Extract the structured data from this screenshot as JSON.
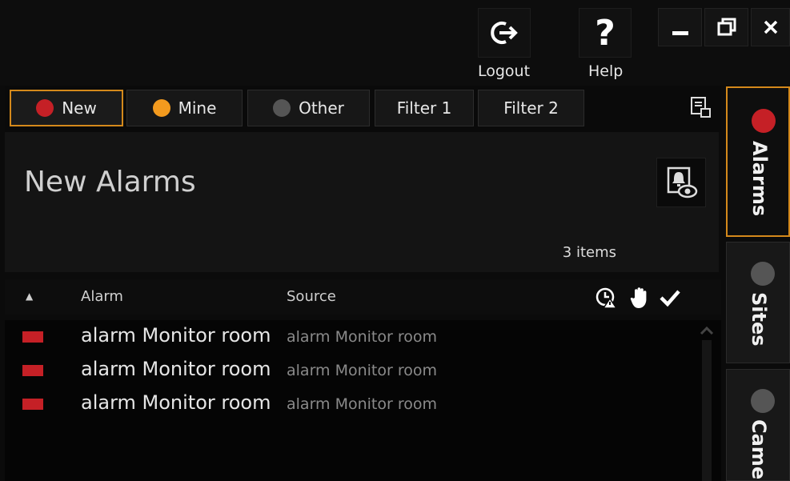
{
  "titlebar": {
    "logout_label": "Logout",
    "help_label": "Help",
    "help_glyph": "?",
    "minimize_glyph": "▁",
    "restore_glyph": "❐",
    "close_glyph": "✕"
  },
  "filters": {
    "tabs": [
      {
        "label": "New",
        "dot_color": "#c52026",
        "active": true
      },
      {
        "label": "Mine",
        "dot_color": "#f39a1e",
        "active": false
      },
      {
        "label": "Other",
        "dot_color": "#555555",
        "active": false
      },
      {
        "label": "Filter 1",
        "active": false
      },
      {
        "label": "Filter 2",
        "active": false
      }
    ],
    "layout_icon": "layout-toggle-icon"
  },
  "main": {
    "title": "New Alarms",
    "count_text": "3 items",
    "view_icon": "alarm-view-icon"
  },
  "table": {
    "sort_glyph": "▲",
    "col_alarm": "Alarm",
    "col_source": "Source",
    "header_icons": [
      "clock-warning-icon",
      "hand-icon",
      "checkmark-icon"
    ],
    "rows": [
      {
        "alarm": "alarm Monitor room",
        "source": "alarm Monitor room",
        "priority_color": "#c52026"
      },
      {
        "alarm": "alarm Monitor room",
        "source": "alarm Monitor room",
        "priority_color": "#c52026"
      },
      {
        "alarm": "alarm Monitor room",
        "source": "alarm Monitor room",
        "priority_color": "#c52026"
      }
    ]
  },
  "sidebar": {
    "tabs": [
      {
        "label": "Alarms",
        "dot_color": "#c52026",
        "active": true
      },
      {
        "label": "Sites",
        "dot_color": "#555555",
        "active": false
      },
      {
        "label": "Came",
        "dot_color": "#555555",
        "active": false
      }
    ]
  },
  "colors": {
    "accent": "#d4891b",
    "background": "#0b0b0b",
    "panel": "#141414"
  }
}
